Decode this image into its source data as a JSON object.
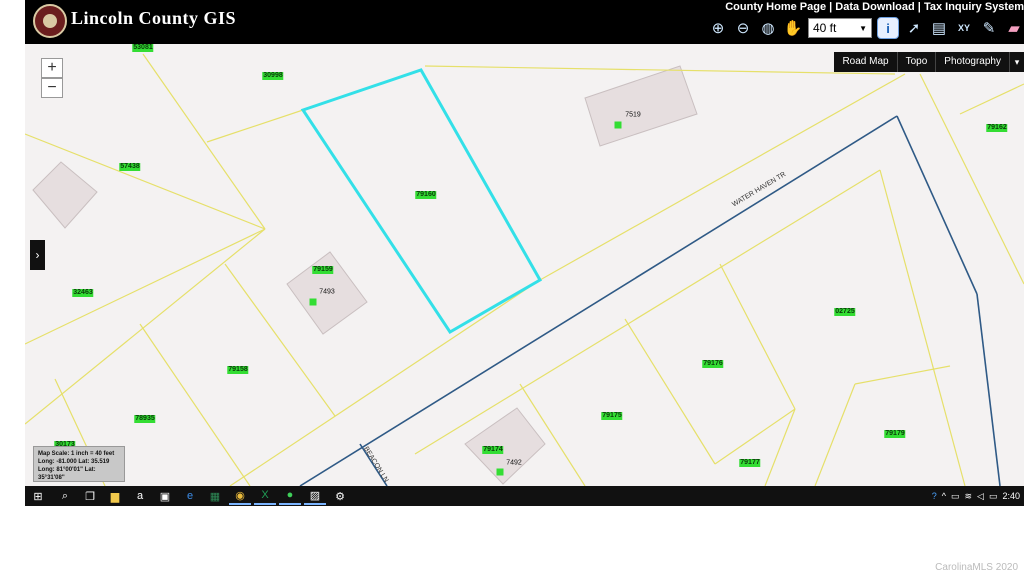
{
  "header": {
    "app_title": "Lincoln County GIS",
    "links": [
      "County Home Page",
      "Data Download",
      "Tax Inquiry System"
    ],
    "separator": " | ",
    "scale_value": "40 ft"
  },
  "toolbar": {
    "icons": [
      "zoom-in-icon",
      "zoom-out-icon",
      "globe-icon",
      "pan-hand-icon",
      "identify-icon",
      "select-arrow-icon",
      "print-icon",
      "xy-coordinate-icon",
      "pencil-icon",
      "eraser-icon"
    ]
  },
  "map": {
    "zoom_in_label": "+",
    "zoom_out_label": "−",
    "basemaps": [
      "Road Map",
      "Topo",
      "Photography"
    ],
    "side_toggle": "›",
    "parcel_ids": [
      "53081",
      "30998",
      "57438",
      "32463",
      "79159",
      "79158",
      "78935",
      "30173",
      "79160",
      "7519",
      "79162",
      "02725",
      "79176",
      "79175",
      "79174",
      "79177",
      "79179"
    ],
    "addresses": [
      "7519",
      "7493",
      "7492"
    ],
    "streets": [
      "WATER HAVEN TR",
      "BEACON LN"
    ],
    "scale_box": {
      "line1": "Map Scale: 1 inch = 40 feet",
      "line2": "Long: -81.000 Lat: 35.519",
      "line3": "Long: 81°00'01\" Lat: 35°31'08\""
    },
    "colors": {
      "parcel_line": "#e6e06a",
      "selected_parcel": "#33e0e8",
      "road": "#2f5a86",
      "building": "#e6dedf",
      "label_bg": "#33dd33"
    }
  },
  "taskbar": {
    "icons": [
      "windows-start-icon",
      "search-icon",
      "task-view-icon",
      "file-explorer-icon",
      "amazon-icon",
      "store-icon",
      "edge-icon",
      "app-icon",
      "chrome-icon",
      "excel-icon",
      "app2-icon",
      "photos-icon",
      "app3-icon"
    ],
    "time": "2:40"
  },
  "watermark": "CarolinaMLS 2020"
}
